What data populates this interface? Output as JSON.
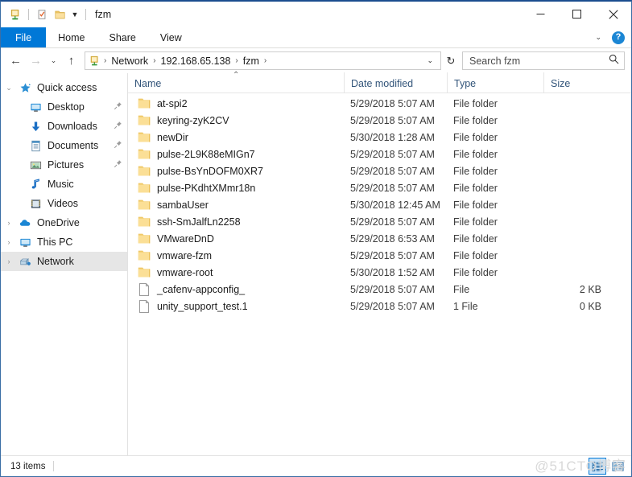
{
  "window": {
    "title": "fzm",
    "quick_access": [
      {
        "name": "network-folder-icon",
        "label": "Network folder"
      },
      {
        "name": "properties-icon",
        "label": "Properties"
      },
      {
        "name": "new-folder-icon",
        "label": "New folder"
      }
    ],
    "controls": {
      "minimize": "—",
      "maximize": "☐",
      "close": "✕"
    }
  },
  "ribbon": {
    "tabs": [
      {
        "label": "File",
        "active": true
      },
      {
        "label": "Home",
        "active": false
      },
      {
        "label": "Share",
        "active": false
      },
      {
        "label": "View",
        "active": false
      }
    ],
    "expand_caret": "⌄",
    "help_label": "?"
  },
  "address": {
    "back": "←",
    "forward": "→",
    "recent_caret": "⌄",
    "up": "↑",
    "breadcrumbs": [
      "Network",
      "192.168.65.138",
      "fzm"
    ],
    "separator": "›",
    "dropdown_caret": "⌄",
    "refresh": "↻"
  },
  "search": {
    "placeholder": "Search fzm",
    "value": "",
    "icon": "search-icon"
  },
  "sidebar": {
    "items": [
      {
        "label": "Quick access",
        "icon": "star-icon",
        "level": 0,
        "chevron": "⌄",
        "pinned": false,
        "selected": false
      },
      {
        "label": "Desktop",
        "icon": "desktop-icon",
        "level": 1,
        "chevron": "",
        "pinned": true,
        "selected": false
      },
      {
        "label": "Downloads",
        "icon": "download-icon",
        "level": 1,
        "chevron": "",
        "pinned": true,
        "selected": false
      },
      {
        "label": "Documents",
        "icon": "documents-icon",
        "level": 1,
        "chevron": "",
        "pinned": true,
        "selected": false
      },
      {
        "label": "Pictures",
        "icon": "pictures-icon",
        "level": 1,
        "chevron": "",
        "pinned": true,
        "selected": false
      },
      {
        "label": "Music",
        "icon": "music-note-icon",
        "level": 1,
        "chevron": "",
        "pinned": false,
        "selected": false
      },
      {
        "label": "Videos",
        "icon": "video-icon",
        "level": 1,
        "chevron": "",
        "pinned": false,
        "selected": false
      },
      {
        "label": "OneDrive",
        "icon": "cloud-icon",
        "level": 0,
        "chevron": "›",
        "pinned": false,
        "selected": false
      },
      {
        "label": "This PC",
        "icon": "monitor-icon",
        "level": 0,
        "chevron": "›",
        "pinned": false,
        "selected": false
      },
      {
        "label": "Network",
        "icon": "network-icon",
        "level": 0,
        "chevron": "›",
        "pinned": false,
        "selected": true
      }
    ],
    "pin_glyph": "📌"
  },
  "filelist": {
    "columns": [
      {
        "label": "Name",
        "key": "name",
        "sorted": "asc"
      },
      {
        "label": "Date modified",
        "key": "date",
        "sorted": ""
      },
      {
        "label": "Type",
        "key": "type",
        "sorted": ""
      },
      {
        "label": "Size",
        "key": "size",
        "sorted": ""
      }
    ],
    "sort_caret": "⌃",
    "rows": [
      {
        "name": "at-spi2",
        "date": "5/29/2018 5:07 AM",
        "type": "File folder",
        "size": "",
        "icon": "folder-icon"
      },
      {
        "name": "keyring-zyK2CV",
        "date": "5/29/2018 5:07 AM",
        "type": "File folder",
        "size": "",
        "icon": "folder-icon"
      },
      {
        "name": "newDir",
        "date": "5/30/2018 1:28 AM",
        "type": "File folder",
        "size": "",
        "icon": "folder-icon"
      },
      {
        "name": "pulse-2L9K88eMIGn7",
        "date": "5/29/2018 5:07 AM",
        "type": "File folder",
        "size": "",
        "icon": "folder-icon"
      },
      {
        "name": "pulse-BsYnDOFM0XR7",
        "date": "5/29/2018 5:07 AM",
        "type": "File folder",
        "size": "",
        "icon": "folder-icon"
      },
      {
        "name": "pulse-PKdhtXMmr18n",
        "date": "5/29/2018 5:07 AM",
        "type": "File folder",
        "size": "",
        "icon": "folder-icon"
      },
      {
        "name": "sambaUser",
        "date": "5/30/2018 12:45 AM",
        "type": "File folder",
        "size": "",
        "icon": "folder-icon"
      },
      {
        "name": "ssh-SmJalfLn2258",
        "date": "5/29/2018 5:07 AM",
        "type": "File folder",
        "size": "",
        "icon": "folder-icon"
      },
      {
        "name": "VMwareDnD",
        "date": "5/29/2018 6:53 AM",
        "type": "File folder",
        "size": "",
        "icon": "folder-icon"
      },
      {
        "name": "vmware-fzm",
        "date": "5/29/2018 5:07 AM",
        "type": "File folder",
        "size": "",
        "icon": "folder-icon"
      },
      {
        "name": "vmware-root",
        "date": "5/30/2018 1:52 AM",
        "type": "File folder",
        "size": "",
        "icon": "folder-icon"
      },
      {
        "name": "_cafenv-appconfig_",
        "date": "5/29/2018 5:07 AM",
        "type": "File",
        "size": "2 KB",
        "icon": "file-icon"
      },
      {
        "name": "unity_support_test.1",
        "date": "5/29/2018 5:07 AM",
        "type": "1 File",
        "size": "0 KB",
        "icon": "file-icon"
      }
    ]
  },
  "statusbar": {
    "item_count": "13 items",
    "watermark": "@51CTO博客",
    "views": [
      {
        "name": "details-view-button",
        "active": true
      },
      {
        "name": "large-icons-view-button",
        "active": false
      }
    ]
  },
  "colors": {
    "accent": "#0078d7",
    "folder": "#f7d072",
    "titlebar_border": "#1a4d8f",
    "selection": "#e6e6e6"
  }
}
